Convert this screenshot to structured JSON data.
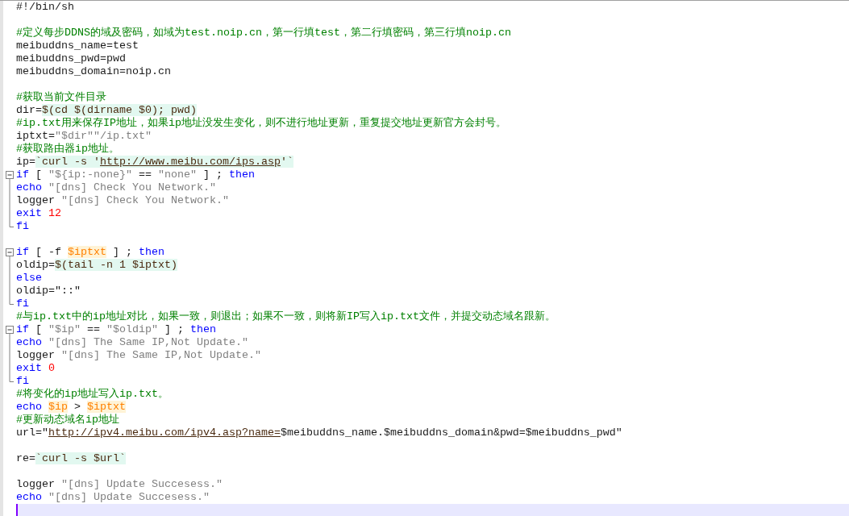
{
  "editor": {
    "lines": [
      {
        "kind": "plain",
        "tokens": [
          {
            "t": "#!/bin/sh",
            "kind": "plain"
          }
        ]
      },
      {
        "kind": "plain"
      },
      {
        "kind": "plain",
        "tokens": [
          {
            "t": "#定义每步DDNS的域及密码，如域为test.noip.cn，第一行填test，第二行填密码，第三行填noip.cn",
            "kind": "comment"
          }
        ]
      },
      {
        "kind": "plain",
        "tokens": [
          {
            "t": "meibuddns_name=test",
            "kind": "plain"
          }
        ]
      },
      {
        "kind": "plain",
        "tokens": [
          {
            "t": "meibuddns_pwd=pwd",
            "kind": "plain"
          }
        ]
      },
      {
        "kind": "plain",
        "tokens": [
          {
            "t": "meibuddns_domain=noip.cn",
            "kind": "plain"
          }
        ]
      },
      {
        "kind": "plain"
      },
      {
        "kind": "plain",
        "tokens": [
          {
            "t": "#获取当前文件目录",
            "kind": "comment"
          }
        ]
      },
      {
        "kind": "plain",
        "tokens": [
          {
            "t": "dir=",
            "kind": "plain"
          },
          {
            "t": "$(cd $(dirname $0); pwd)",
            "kind": "shell"
          }
        ]
      },
      {
        "kind": "plain",
        "tokens": [
          {
            "t": "#ip.txt用来保存IP地址，如果ip地址没发生变化，则不进行地址更新，重复提交地址更新官方会封号。",
            "kind": "comment"
          }
        ]
      },
      {
        "kind": "plain",
        "tokens": [
          {
            "t": "iptxt=",
            "kind": "plain"
          },
          {
            "t": "\"$dir\"\"/ip.txt\"",
            "kind": "string"
          }
        ]
      },
      {
        "kind": "plain",
        "tokens": [
          {
            "t": "#获取路由器ip地址。",
            "kind": "comment"
          }
        ]
      },
      {
        "kind": "plain",
        "tokens": [
          {
            "t": "ip=",
            "kind": "plain"
          },
          {
            "t": "`curl -s '",
            "kind": "shell"
          },
          {
            "t": "http://www.meibu.com/ips.asp",
            "kind": "shelllink"
          },
          {
            "t": "'`",
            "kind": "shell"
          }
        ]
      },
      {
        "kind": "start",
        "tokens": [
          {
            "t": "if",
            "kind": "keyword"
          },
          {
            "t": " [ ",
            "kind": "plain"
          },
          {
            "t": "\"${ip:-none}\"",
            "kind": "string"
          },
          {
            "t": " == ",
            "kind": "plain"
          },
          {
            "t": "\"none\"",
            "kind": "string"
          },
          {
            "t": " ] ; ",
            "kind": "plain"
          },
          {
            "t": "then",
            "kind": "keyword"
          }
        ]
      },
      {
        "kind": "body",
        "tokens": [
          {
            "t": "echo ",
            "kind": "keyword"
          },
          {
            "t": "\"[dns] Check You Network.\"",
            "kind": "string"
          }
        ]
      },
      {
        "kind": "body",
        "tokens": [
          {
            "t": "logger ",
            "kind": "plain"
          },
          {
            "t": "\"[dns] Check You Network.\"",
            "kind": "string"
          }
        ]
      },
      {
        "kind": "body",
        "tokens": [
          {
            "t": "exit ",
            "kind": "keyword"
          },
          {
            "t": "12",
            "kind": "number"
          }
        ]
      },
      {
        "kind": "end",
        "tokens": [
          {
            "t": "fi",
            "kind": "keyword"
          }
        ]
      },
      {
        "kind": "plain"
      },
      {
        "kind": "start",
        "tokens": [
          {
            "t": "if",
            "kind": "keyword"
          },
          {
            "t": " [ -f ",
            "kind": "plain"
          },
          {
            "t": "$iptxt",
            "kind": "variable"
          },
          {
            "t": " ] ; ",
            "kind": "plain"
          },
          {
            "t": "then",
            "kind": "keyword"
          }
        ]
      },
      {
        "kind": "body",
        "tokens": [
          {
            "t": "oldip=",
            "kind": "plain"
          },
          {
            "t": "$(tail -n 1 $iptxt)",
            "kind": "shell"
          }
        ]
      },
      {
        "kind": "body",
        "tokens": [
          {
            "t": "else",
            "kind": "keyword"
          }
        ]
      },
      {
        "kind": "body",
        "tokens": [
          {
            "t": "oldip=\"::\"",
            "kind": "plain"
          }
        ]
      },
      {
        "kind": "end",
        "tokens": [
          {
            "t": "fi",
            "kind": "keyword"
          }
        ]
      },
      {
        "kind": "plain",
        "tokens": [
          {
            "t": "#与ip.txt中的ip地址对比，如果一致，则退出；如果不一致，则将新IP写入ip.txt文件，并提交动态域名跟新。",
            "kind": "comment"
          }
        ]
      },
      {
        "kind": "start",
        "tokens": [
          {
            "t": "if",
            "kind": "keyword"
          },
          {
            "t": " [ ",
            "kind": "plain"
          },
          {
            "t": "\"$ip\"",
            "kind": "string"
          },
          {
            "t": " == ",
            "kind": "plain"
          },
          {
            "t": "\"$oldip\"",
            "kind": "string"
          },
          {
            "t": " ] ; ",
            "kind": "plain"
          },
          {
            "t": "then",
            "kind": "keyword"
          }
        ]
      },
      {
        "kind": "body",
        "tokens": [
          {
            "t": "echo ",
            "kind": "keyword"
          },
          {
            "t": "\"[dns] The Same IP,Not Update.\"",
            "kind": "string"
          }
        ]
      },
      {
        "kind": "body",
        "tokens": [
          {
            "t": "logger ",
            "kind": "plain"
          },
          {
            "t": "\"[dns] The Same IP,Not Update.\"",
            "kind": "string"
          }
        ]
      },
      {
        "kind": "body",
        "tokens": [
          {
            "t": "exit ",
            "kind": "keyword"
          },
          {
            "t": "0",
            "kind": "number"
          }
        ]
      },
      {
        "kind": "end",
        "tokens": [
          {
            "t": "fi",
            "kind": "keyword"
          }
        ]
      },
      {
        "kind": "plain",
        "tokens": [
          {
            "t": "#将变化的ip地址写入ip.txt。",
            "kind": "comment"
          }
        ]
      },
      {
        "kind": "plain",
        "tokens": [
          {
            "t": "echo ",
            "kind": "keyword"
          },
          {
            "t": "$ip",
            "kind": "variable"
          },
          {
            "t": " > ",
            "kind": "plain"
          },
          {
            "t": "$iptxt",
            "kind": "variable"
          }
        ]
      },
      {
        "kind": "plain",
        "tokens": [
          {
            "t": "#更新动态域名ip地址",
            "kind": "comment"
          }
        ]
      },
      {
        "kind": "plain",
        "tokens": [
          {
            "t": "url=\"",
            "kind": "plain"
          },
          {
            "t": "http://ipv4.meibu.com/ipv4.asp?name=",
            "kind": "link"
          },
          {
            "t": "$meibuddns_name.$meibuddns_domain&pwd=$meibuddns_pwd\"",
            "kind": "plain"
          }
        ]
      },
      {
        "kind": "plain"
      },
      {
        "kind": "plain",
        "tokens": [
          {
            "t": "re=",
            "kind": "plain"
          },
          {
            "t": "`curl -s $url`",
            "kind": "shell"
          }
        ]
      },
      {
        "kind": "plain"
      },
      {
        "kind": "plain",
        "tokens": [
          {
            "t": "logger ",
            "kind": "plain"
          },
          {
            "t": "\"[dns] Update Succesess.\"",
            "kind": "string"
          }
        ]
      },
      {
        "kind": "plain",
        "tokens": [
          {
            "t": "echo ",
            "kind": "keyword"
          },
          {
            "t": "\"[dns] Update Succesess.\"",
            "kind": "string"
          }
        ]
      },
      {
        "kind": "cursor"
      }
    ]
  }
}
